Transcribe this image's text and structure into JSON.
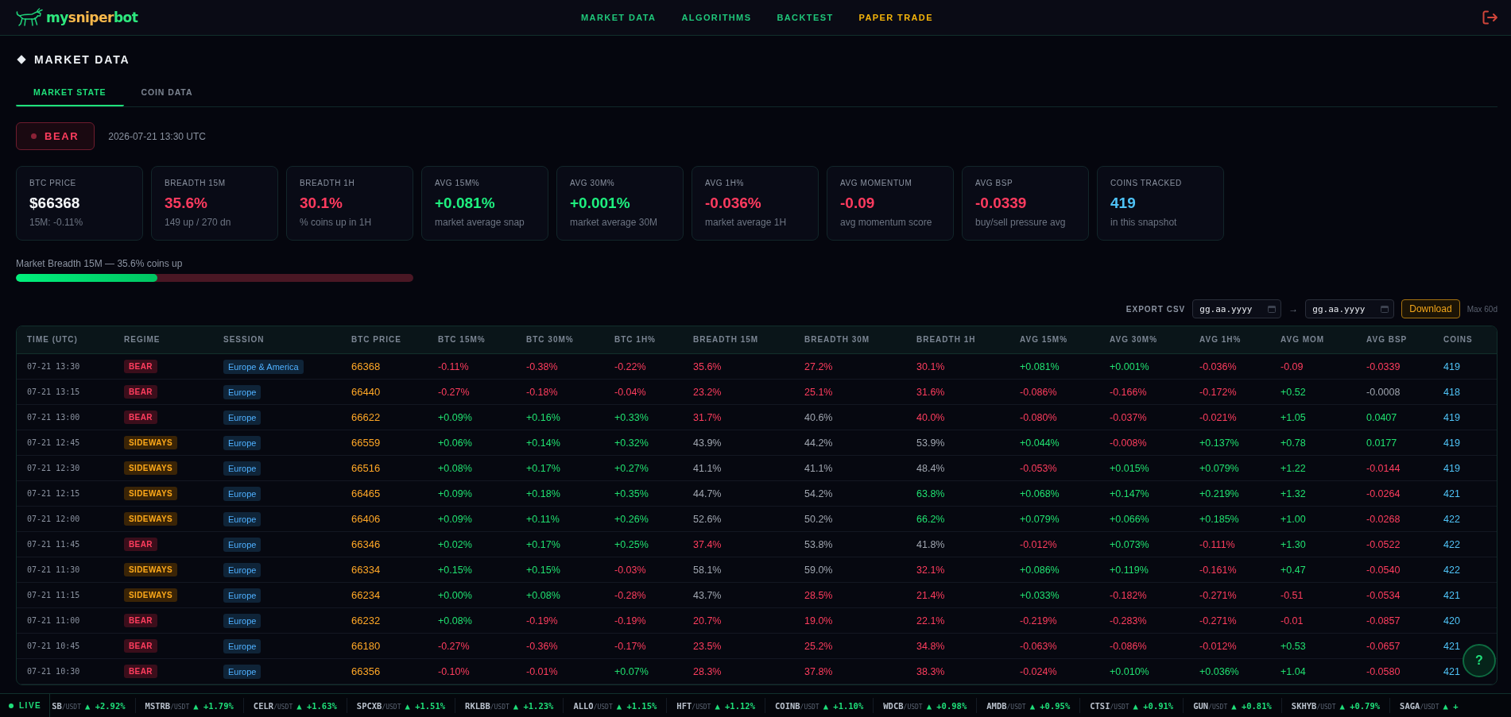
{
  "navbar": {
    "logo": [
      {
        "text": "my",
        "color": "#2ee87e"
      },
      {
        "text": "sniper",
        "color": "#f7b84b"
      },
      {
        "text": "bot",
        "color": "#2ee87e"
      }
    ],
    "links": [
      {
        "label": "MARKET DATA",
        "kind": "link"
      },
      {
        "label": "ALGORITHMS",
        "kind": "link"
      },
      {
        "label": "BACKTEST",
        "kind": "link"
      },
      {
        "label": "PAPER TRADE",
        "kind": "highlight"
      }
    ]
  },
  "page": {
    "title": "MARKET DATA"
  },
  "tabs": [
    {
      "label": "MARKET STATE",
      "selected": true
    },
    {
      "label": "COIN DATA",
      "selected": false
    }
  ],
  "regime": {
    "label": "BEAR",
    "kind": "bear",
    "timestamp": "2026-07-21 13:30 UTC"
  },
  "stats": [
    {
      "label": "BTC PRICE",
      "value": "$66368",
      "note": "15M: -0.11%",
      "kind": "plain"
    },
    {
      "label": "BREADTH 15M",
      "value": "35.6%",
      "note": "149 up / 270 dn",
      "kind": "down"
    },
    {
      "label": "BREADTH 1H",
      "value": "30.1%",
      "note": "% coins up in 1H",
      "kind": "down"
    },
    {
      "label": "AVG 15M%",
      "value": "+0.081%",
      "note": "market average snap",
      "kind": "up"
    },
    {
      "label": "AVG 30M%",
      "value": "+0.001%",
      "note": "market average 30M",
      "kind": "up"
    },
    {
      "label": "AVG 1H%",
      "value": "-0.036%",
      "note": "market average 1H",
      "kind": "down"
    },
    {
      "label": "AVG MOMENTUM",
      "value": "-0.09",
      "note": "avg momentum score",
      "kind": "down"
    },
    {
      "label": "AVG BSP",
      "value": "-0.0339",
      "note": "buy/sell pressure avg",
      "kind": "down"
    },
    {
      "label": "COINS TRACKED",
      "value": "419",
      "note": "in this snapshot",
      "kind": "info"
    }
  ],
  "breadth": {
    "caption": "Market Breadth 15M — 35.6% coins up",
    "level": 0.356
  },
  "export": {
    "label": "EXPORT CSV",
    "from": {
      "placeholder": "gg.aa.yyyy"
    },
    "separator": "→",
    "to": {
      "placeholder": "gg.aa.yyyy"
    },
    "button": "Download",
    "limit": "Max 60d"
  },
  "table": {
    "columns": [
      "TIME (UTC)",
      "REGIME",
      "SESSION",
      "BTC PRICE",
      "BTC 15M%",
      "BTC 30M%",
      "BTC 1H%",
      "BREADTH 15M",
      "BREADTH 30M",
      "BREADTH 1H",
      "AVG 15M%",
      "AVG 30M%",
      "AVG 1H%",
      "AVG MOM",
      "AVG BSP",
      "COINS"
    ],
    "rows": [
      {
        "cells": [
          {
            "text": "07-21 13:30",
            "kind": "time"
          },
          {
            "text": "BEAR",
            "kind": "bear"
          },
          {
            "text": "Europe & America",
            "kind": "session"
          },
          {
            "text": "66368",
            "kind": "price"
          },
          {
            "text": "-0.11%",
            "kind": "down"
          },
          {
            "text": "-0.38%",
            "kind": "down"
          },
          {
            "text": "-0.22%",
            "kind": "down"
          },
          {
            "text": "35.6%",
            "kind": "down"
          },
          {
            "text": "27.2%",
            "kind": "down"
          },
          {
            "text": "30.1%",
            "kind": "down"
          },
          {
            "text": "+0.081%",
            "kind": "up"
          },
          {
            "text": "+0.001%",
            "kind": "up"
          },
          {
            "text": "-0.036%",
            "kind": "down"
          },
          {
            "text": "-0.09",
            "kind": "down"
          },
          {
            "text": "-0.0339",
            "kind": "down"
          },
          {
            "text": "419",
            "kind": "coins"
          }
        ]
      },
      {
        "cells": [
          {
            "text": "07-21 13:15",
            "kind": "time"
          },
          {
            "text": "BEAR",
            "kind": "bear"
          },
          {
            "text": "Europe",
            "kind": "session"
          },
          {
            "text": "66440",
            "kind": "price"
          },
          {
            "text": "-0.27%",
            "kind": "down"
          },
          {
            "text": "-0.18%",
            "kind": "down"
          },
          {
            "text": "-0.04%",
            "kind": "down"
          },
          {
            "text": "23.2%",
            "kind": "down"
          },
          {
            "text": "25.1%",
            "kind": "down"
          },
          {
            "text": "31.6%",
            "kind": "down"
          },
          {
            "text": "-0.086%",
            "kind": "down"
          },
          {
            "text": "-0.166%",
            "kind": "down"
          },
          {
            "text": "-0.172%",
            "kind": "down"
          },
          {
            "text": "+0.52",
            "kind": "up"
          },
          {
            "text": "-0.0008",
            "kind": "flat"
          },
          {
            "text": "418",
            "kind": "coins"
          }
        ]
      },
      {
        "cells": [
          {
            "text": "07-21 13:00",
            "kind": "time"
          },
          {
            "text": "BEAR",
            "kind": "bear"
          },
          {
            "text": "Europe",
            "kind": "session"
          },
          {
            "text": "66622",
            "kind": "price"
          },
          {
            "text": "+0.09%",
            "kind": "up"
          },
          {
            "text": "+0.16%",
            "kind": "up"
          },
          {
            "text": "+0.33%",
            "kind": "up"
          },
          {
            "text": "31.7%",
            "kind": "down"
          },
          {
            "text": "40.6%",
            "kind": "flat"
          },
          {
            "text": "40.0%",
            "kind": "down"
          },
          {
            "text": "-0.080%",
            "kind": "down"
          },
          {
            "text": "-0.037%",
            "kind": "down"
          },
          {
            "text": "-0.021%",
            "kind": "down"
          },
          {
            "text": "+1.05",
            "kind": "up"
          },
          {
            "text": "0.0407",
            "kind": "up"
          },
          {
            "text": "419",
            "kind": "coins"
          }
        ]
      },
      {
        "cells": [
          {
            "text": "07-21 12:45",
            "kind": "time"
          },
          {
            "text": "SIDEWAYS",
            "kind": "sideways"
          },
          {
            "text": "Europe",
            "kind": "session"
          },
          {
            "text": "66559",
            "kind": "price"
          },
          {
            "text": "+0.06%",
            "kind": "up"
          },
          {
            "text": "+0.14%",
            "kind": "up"
          },
          {
            "text": "+0.32%",
            "kind": "up"
          },
          {
            "text": "43.9%",
            "kind": "flat"
          },
          {
            "text": "44.2%",
            "kind": "flat"
          },
          {
            "text": "53.9%",
            "kind": "flat"
          },
          {
            "text": "+0.044%",
            "kind": "up"
          },
          {
            "text": "-0.008%",
            "kind": "down"
          },
          {
            "text": "+0.137%",
            "kind": "up"
          },
          {
            "text": "+0.78",
            "kind": "up"
          },
          {
            "text": "0.0177",
            "kind": "up"
          },
          {
            "text": "419",
            "kind": "coins"
          }
        ]
      },
      {
        "cells": [
          {
            "text": "07-21 12:30",
            "kind": "time"
          },
          {
            "text": "SIDEWAYS",
            "kind": "sideways"
          },
          {
            "text": "Europe",
            "kind": "session"
          },
          {
            "text": "66516",
            "kind": "price"
          },
          {
            "text": "+0.08%",
            "kind": "up"
          },
          {
            "text": "+0.17%",
            "kind": "up"
          },
          {
            "text": "+0.27%",
            "kind": "up"
          },
          {
            "text": "41.1%",
            "kind": "flat"
          },
          {
            "text": "41.1%",
            "kind": "flat"
          },
          {
            "text": "48.4%",
            "kind": "flat"
          },
          {
            "text": "-0.053%",
            "kind": "down"
          },
          {
            "text": "+0.015%",
            "kind": "up"
          },
          {
            "text": "+0.079%",
            "kind": "up"
          },
          {
            "text": "+1.22",
            "kind": "up"
          },
          {
            "text": "-0.0144",
            "kind": "down"
          },
          {
            "text": "419",
            "kind": "coins"
          }
        ]
      },
      {
        "cells": [
          {
            "text": "07-21 12:15",
            "kind": "time"
          },
          {
            "text": "SIDEWAYS",
            "kind": "sideways"
          },
          {
            "text": "Europe",
            "kind": "session"
          },
          {
            "text": "66465",
            "kind": "price"
          },
          {
            "text": "+0.09%",
            "kind": "up"
          },
          {
            "text": "+0.18%",
            "kind": "up"
          },
          {
            "text": "+0.35%",
            "kind": "up"
          },
          {
            "text": "44.7%",
            "kind": "flat"
          },
          {
            "text": "54.2%",
            "kind": "flat"
          },
          {
            "text": "63.8%",
            "kind": "up"
          },
          {
            "text": "+0.068%",
            "kind": "up"
          },
          {
            "text": "+0.147%",
            "kind": "up"
          },
          {
            "text": "+0.219%",
            "kind": "up"
          },
          {
            "text": "+1.32",
            "kind": "up"
          },
          {
            "text": "-0.0264",
            "kind": "down"
          },
          {
            "text": "421",
            "kind": "coins"
          }
        ]
      },
      {
        "cells": [
          {
            "text": "07-21 12:00",
            "kind": "time"
          },
          {
            "text": "SIDEWAYS",
            "kind": "sideways"
          },
          {
            "text": "Europe",
            "kind": "session"
          },
          {
            "text": "66406",
            "kind": "price"
          },
          {
            "text": "+0.09%",
            "kind": "up"
          },
          {
            "text": "+0.11%",
            "kind": "up"
          },
          {
            "text": "+0.26%",
            "kind": "up"
          },
          {
            "text": "52.6%",
            "kind": "flat"
          },
          {
            "text": "50.2%",
            "kind": "flat"
          },
          {
            "text": "66.2%",
            "kind": "up"
          },
          {
            "text": "+0.079%",
            "kind": "up"
          },
          {
            "text": "+0.066%",
            "kind": "up"
          },
          {
            "text": "+0.185%",
            "kind": "up"
          },
          {
            "text": "+1.00",
            "kind": "up"
          },
          {
            "text": "-0.0268",
            "kind": "down"
          },
          {
            "text": "422",
            "kind": "coins"
          }
        ]
      },
      {
        "cells": [
          {
            "text": "07-21 11:45",
            "kind": "time"
          },
          {
            "text": "BEAR",
            "kind": "bear"
          },
          {
            "text": "Europe",
            "kind": "session"
          },
          {
            "text": "66346",
            "kind": "price"
          },
          {
            "text": "+0.02%",
            "kind": "up"
          },
          {
            "text": "+0.17%",
            "kind": "up"
          },
          {
            "text": "+0.25%",
            "kind": "up"
          },
          {
            "text": "37.4%",
            "kind": "down"
          },
          {
            "text": "53.8%",
            "kind": "flat"
          },
          {
            "text": "41.8%",
            "kind": "flat"
          },
          {
            "text": "-0.012%",
            "kind": "down"
          },
          {
            "text": "+0.073%",
            "kind": "up"
          },
          {
            "text": "-0.111%",
            "kind": "down"
          },
          {
            "text": "+1.30",
            "kind": "up"
          },
          {
            "text": "-0.0522",
            "kind": "down"
          },
          {
            "text": "422",
            "kind": "coins"
          }
        ]
      },
      {
        "cells": [
          {
            "text": "07-21 11:30",
            "kind": "time"
          },
          {
            "text": "SIDEWAYS",
            "kind": "sideways"
          },
          {
            "text": "Europe",
            "kind": "session"
          },
          {
            "text": "66334",
            "kind": "price"
          },
          {
            "text": "+0.15%",
            "kind": "up"
          },
          {
            "text": "+0.15%",
            "kind": "up"
          },
          {
            "text": "-0.03%",
            "kind": "down"
          },
          {
            "text": "58.1%",
            "kind": "flat"
          },
          {
            "text": "59.0%",
            "kind": "flat"
          },
          {
            "text": "32.1%",
            "kind": "down"
          },
          {
            "text": "+0.086%",
            "kind": "up"
          },
          {
            "text": "+0.119%",
            "kind": "up"
          },
          {
            "text": "-0.161%",
            "kind": "down"
          },
          {
            "text": "+0.47",
            "kind": "up"
          },
          {
            "text": "-0.0540",
            "kind": "down"
          },
          {
            "text": "422",
            "kind": "coins"
          }
        ]
      },
      {
        "cells": [
          {
            "text": "07-21 11:15",
            "kind": "time"
          },
          {
            "text": "SIDEWAYS",
            "kind": "sideways"
          },
          {
            "text": "Europe",
            "kind": "session"
          },
          {
            "text": "66234",
            "kind": "price"
          },
          {
            "text": "+0.00%",
            "kind": "up"
          },
          {
            "text": "+0.08%",
            "kind": "up"
          },
          {
            "text": "-0.28%",
            "kind": "down"
          },
          {
            "text": "43.7%",
            "kind": "flat"
          },
          {
            "text": "28.5%",
            "kind": "down"
          },
          {
            "text": "21.4%",
            "kind": "down"
          },
          {
            "text": "+0.033%",
            "kind": "up"
          },
          {
            "text": "-0.182%",
            "kind": "down"
          },
          {
            "text": "-0.271%",
            "kind": "down"
          },
          {
            "text": "-0.51",
            "kind": "down"
          },
          {
            "text": "-0.0534",
            "kind": "down"
          },
          {
            "text": "421",
            "kind": "coins"
          }
        ]
      },
      {
        "cells": [
          {
            "text": "07-21 11:00",
            "kind": "time"
          },
          {
            "text": "BEAR",
            "kind": "bear"
          },
          {
            "text": "Europe",
            "kind": "session"
          },
          {
            "text": "66232",
            "kind": "price"
          },
          {
            "text": "+0.08%",
            "kind": "up"
          },
          {
            "text": "-0.19%",
            "kind": "down"
          },
          {
            "text": "-0.19%",
            "kind": "down"
          },
          {
            "text": "20.7%",
            "kind": "down"
          },
          {
            "text": "19.0%",
            "kind": "down"
          },
          {
            "text": "22.1%",
            "kind": "down"
          },
          {
            "text": "-0.219%",
            "kind": "down"
          },
          {
            "text": "-0.283%",
            "kind": "down"
          },
          {
            "text": "-0.271%",
            "kind": "down"
          },
          {
            "text": "-0.01",
            "kind": "down"
          },
          {
            "text": "-0.0857",
            "kind": "down"
          },
          {
            "text": "420",
            "kind": "coins"
          }
        ]
      },
      {
        "cells": [
          {
            "text": "07-21 10:45",
            "kind": "time"
          },
          {
            "text": "BEAR",
            "kind": "bear"
          },
          {
            "text": "Europe",
            "kind": "session"
          },
          {
            "text": "66180",
            "kind": "price"
          },
          {
            "text": "-0.27%",
            "kind": "down"
          },
          {
            "text": "-0.36%",
            "kind": "down"
          },
          {
            "text": "-0.17%",
            "kind": "down"
          },
          {
            "text": "23.5%",
            "kind": "down"
          },
          {
            "text": "25.2%",
            "kind": "down"
          },
          {
            "text": "34.8%",
            "kind": "down"
          },
          {
            "text": "-0.063%",
            "kind": "down"
          },
          {
            "text": "-0.086%",
            "kind": "down"
          },
          {
            "text": "-0.012%",
            "kind": "down"
          },
          {
            "text": "+0.53",
            "kind": "up"
          },
          {
            "text": "-0.0657",
            "kind": "down"
          },
          {
            "text": "421",
            "kind": "coins"
          }
        ]
      },
      {
        "cells": [
          {
            "text": "07-21 10:30",
            "kind": "time"
          },
          {
            "text": "BEAR",
            "kind": "bear"
          },
          {
            "text": "Europe",
            "kind": "session"
          },
          {
            "text": "66356",
            "kind": "price"
          },
          {
            "text": "-0.10%",
            "kind": "down"
          },
          {
            "text": "-0.01%",
            "kind": "down"
          },
          {
            "text": "+0.07%",
            "kind": "up"
          },
          {
            "text": "28.3%",
            "kind": "down"
          },
          {
            "text": "37.8%",
            "kind": "down"
          },
          {
            "text": "38.3%",
            "kind": "down"
          },
          {
            "text": "-0.024%",
            "kind": "down"
          },
          {
            "text": "+0.010%",
            "kind": "up"
          },
          {
            "text": "+0.036%",
            "kind": "up"
          },
          {
            "text": "+1.04",
            "kind": "up"
          },
          {
            "text": "-0.0580",
            "kind": "down"
          },
          {
            "text": "421",
            "kind": "coins"
          }
        ]
      }
    ]
  },
  "help_button": "?",
  "ticker": {
    "live": "LIVE",
    "items": [
      {
        "symbol": "SB",
        "quote": "/USDT",
        "change": "▲ +2.92%"
      },
      {
        "symbol": "MSTRB",
        "quote": "/USDT",
        "change": "▲ +1.79%"
      },
      {
        "symbol": "CELR",
        "quote": "/USDT",
        "change": "▲ +1.63%"
      },
      {
        "symbol": "SPCXB",
        "quote": "/USDT",
        "change": "▲ +1.51%"
      },
      {
        "symbol": "RKLBB",
        "quote": "/USDT",
        "change": "▲ +1.23%"
      },
      {
        "symbol": "ALLO",
        "quote": "/USDT",
        "change": "▲ +1.15%"
      },
      {
        "symbol": "HFT",
        "quote": "/USDT",
        "change": "▲ +1.12%"
      },
      {
        "symbol": "COINB",
        "quote": "/USDT",
        "change": "▲ +1.10%"
      },
      {
        "symbol": "WDCB",
        "quote": "/USDT",
        "change": "▲ +0.98%"
      },
      {
        "symbol": "AMDB",
        "quote": "/USDT",
        "change": "▲ +0.95%"
      },
      {
        "symbol": "CTSI",
        "quote": "/USDT",
        "change": "▲ +0.91%"
      },
      {
        "symbol": "GUN",
        "quote": "/USDT",
        "change": "▲ +0.81%"
      },
      {
        "symbol": "SKHYB",
        "quote": "/USDT",
        "change": "▲ +0.79%"
      },
      {
        "symbol": "SAGA",
        "quote": "/USDT",
        "change": "▲ +"
      }
    ]
  }
}
